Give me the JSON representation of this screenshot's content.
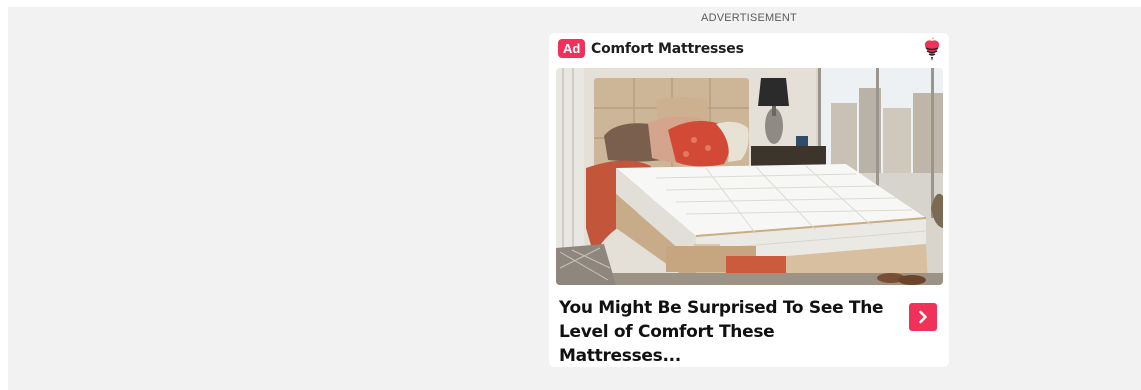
{
  "ad": {
    "section_label": "ADVERTISEMENT",
    "badge": "Ad",
    "advertiser": "Comfort Mattresses",
    "headline": "You Might Be Surprised To See The Level of Comfort These Mattresses...",
    "image_alt": "bed-with-mattress-photo",
    "cta_icon": "chevron-right-icon",
    "logo_icon": "heart-logo-icon"
  },
  "colors": {
    "accent": "#f0325b",
    "panel_bg": "#f2f2f2",
    "card_bg": "#ffffff",
    "headline_text": "#111111"
  }
}
